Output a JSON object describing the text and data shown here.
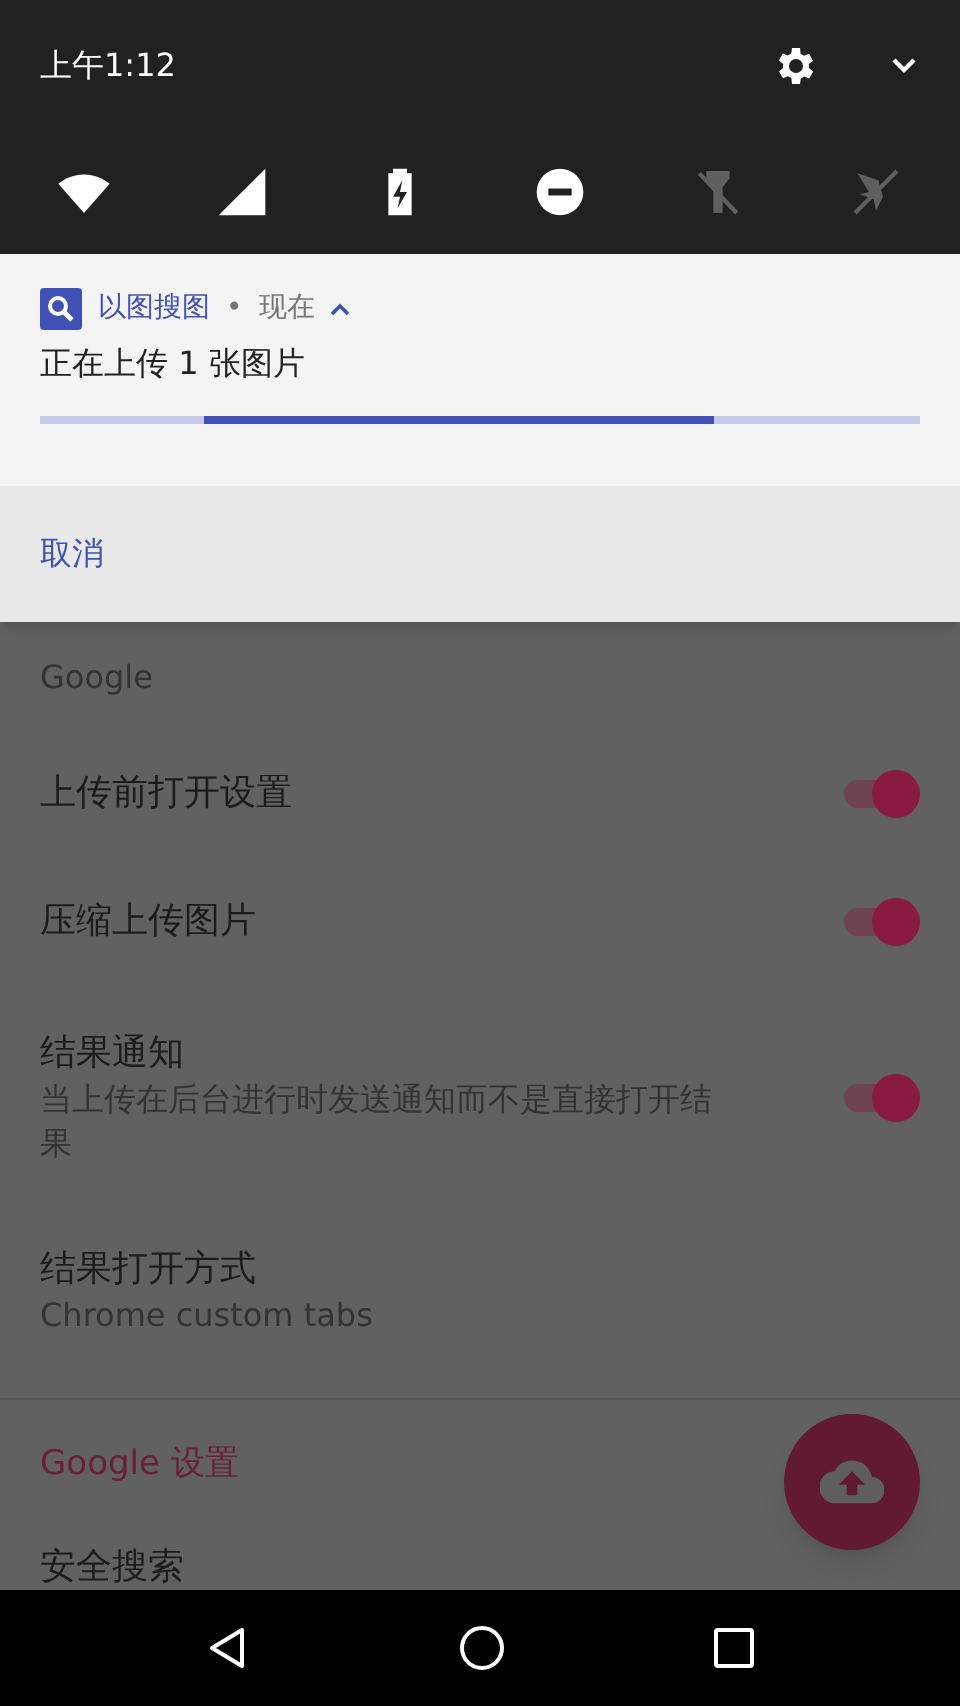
{
  "status_bar": {
    "time": "上午1:12"
  },
  "quick_settings": [
    {
      "kind": "wifi",
      "on": true
    },
    {
      "kind": "signal",
      "on": true
    },
    {
      "kind": "battery",
      "on": true
    },
    {
      "kind": "dnd",
      "on": true
    },
    {
      "kind": "flashlight",
      "on": false
    },
    {
      "kind": "airplane",
      "on": false
    }
  ],
  "notification": {
    "app": "以图搜图",
    "separator": "•",
    "time": "现在",
    "expanded": true,
    "title": "正在上传 1 张图片",
    "action": "取消"
  },
  "settings": [
    {
      "kind": "item",
      "summary": "Google"
    },
    {
      "kind": "switch",
      "title": "上传前打开设置",
      "checked": true
    },
    {
      "kind": "switch",
      "title": "压缩上传图片",
      "checked": true
    },
    {
      "kind": "switch",
      "title": "结果通知",
      "summary": "当上传在后台进行时发送通知而不是直接打开结果",
      "checked": true
    },
    {
      "kind": "item",
      "title": "结果打开方式",
      "summary": "Chrome custom tabs"
    },
    {
      "kind": "category",
      "title": "Google 设置"
    },
    {
      "kind": "item",
      "title": "安全搜索"
    }
  ]
}
